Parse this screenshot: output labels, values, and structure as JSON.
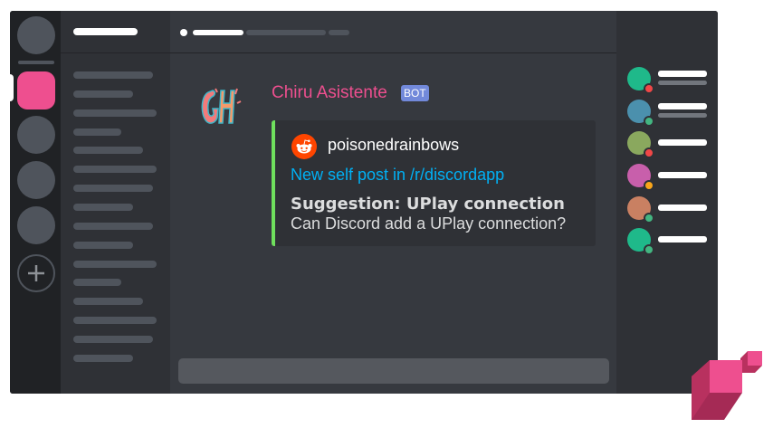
{
  "message": {
    "username": "Chiru Asistente",
    "bot_tag": "BOT"
  },
  "embed": {
    "author": "poisonedrainbows",
    "link": "New self post in /r/discordapp",
    "title": "Suggestion: UPlay connection",
    "description": "Can Discord add a UPlay connection?",
    "accent_color": "#6fe05d"
  },
  "colors": {
    "brand_pink": "#ee4f8f",
    "link": "#00b0f4",
    "bot_tag": "#7289da"
  },
  "members": [
    {
      "avatar_color": "#1fb98a",
      "status": "dnd"
    },
    {
      "avatar_color": "#4b90ad",
      "status": "online"
    },
    {
      "avatar_color": "#8aa85e",
      "status": "dnd"
    },
    {
      "avatar_color": "#c85fab",
      "status": "idle"
    },
    {
      "avatar_color": "#c98062",
      "status": "online"
    },
    {
      "avatar_color": "#1fb98a",
      "status": "online"
    }
  ]
}
